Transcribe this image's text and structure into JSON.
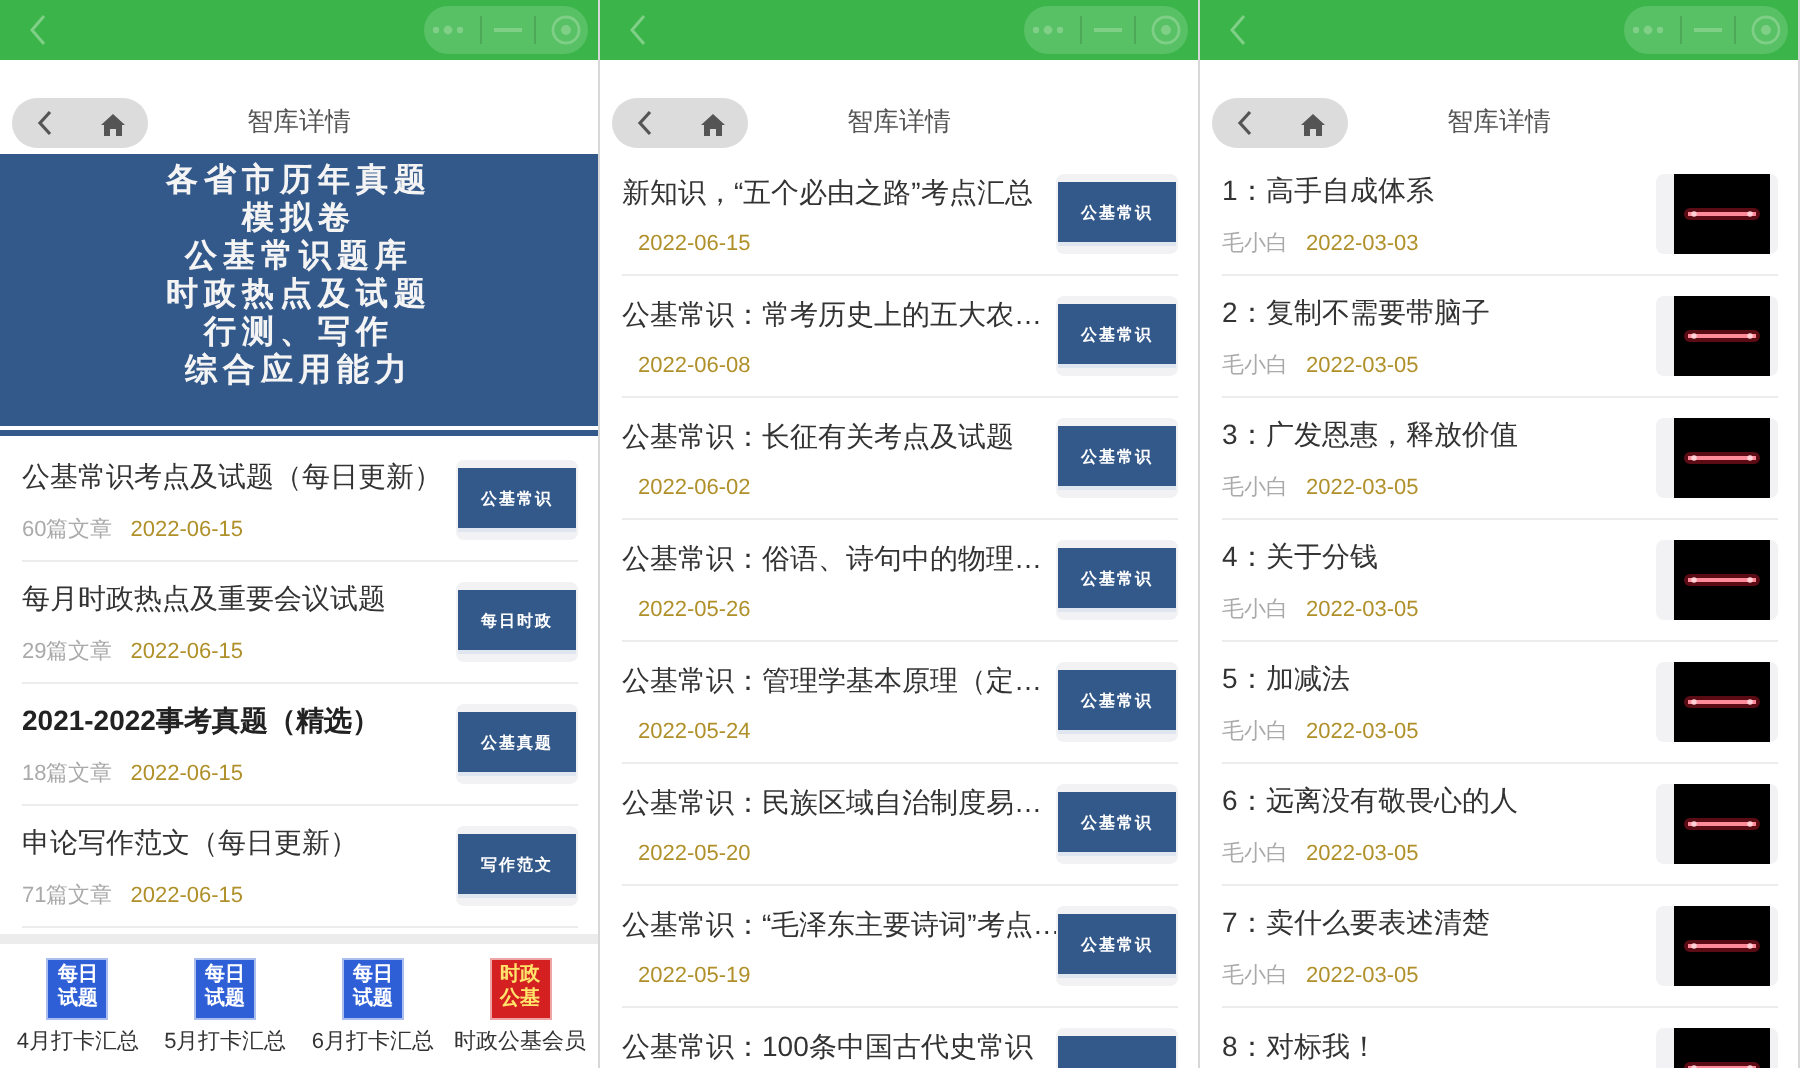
{
  "panels": [
    {
      "kind": "categories",
      "title": "智库详情",
      "banner": {
        "lines": [
          "各省市历年真题",
          "模拟卷",
          "公基常识题库",
          "时政热点及试题",
          "行测、写作",
          "综合应用能力"
        ]
      },
      "rows": [
        {
          "title": "公基常识考点及试题（每日更新）",
          "bold": false,
          "count": "60篇文章",
          "date": "2022-06-15",
          "thumb": {
            "kind": "cover",
            "text": "公基常识"
          }
        },
        {
          "title": "每月时政热点及重要会议试题",
          "bold": false,
          "count": "29篇文章",
          "date": "2022-06-15",
          "thumb": {
            "kind": "cover",
            "text": "每日时政"
          }
        },
        {
          "title": "2021-2022事考真题（精选）",
          "bold": true,
          "count": "18篇文章",
          "date": "2022-06-15",
          "thumb": {
            "kind": "cover",
            "text": "公基真题"
          }
        },
        {
          "title": "申论写作范文（每日更新）",
          "bold": false,
          "count": "71篇文章",
          "date": "2022-06-15",
          "thumb": {
            "kind": "cover",
            "text": "写作范文"
          }
        }
      ],
      "bottom_nav": [
        {
          "icon_lines": [
            "每日",
            "试题"
          ],
          "color": "#2f5fd6",
          "label": "4月打卡汇总"
        },
        {
          "icon_lines": [
            "每日",
            "试题"
          ],
          "color": "#2f5fd6",
          "label": "5月打卡汇总"
        },
        {
          "icon_lines": [
            "每日",
            "试题"
          ],
          "color": "#2f5fd6",
          "label": "6月打卡汇总"
        },
        {
          "icon_lines": [
            "时政",
            "公基"
          ],
          "color": "#d42020",
          "label": "时政公基会员"
        }
      ]
    },
    {
      "kind": "articles",
      "title": "智库详情",
      "rows": [
        {
          "title": "新知识，“五个必由之路”考点汇总",
          "date": "2022-06-15",
          "thumb": {
            "kind": "cover",
            "text": "公基常识"
          }
        },
        {
          "title": "公基常识：常考历史上的五大农…",
          "date": "2022-06-08",
          "thumb": {
            "kind": "cover",
            "text": "公基常识"
          }
        },
        {
          "title": "公基常识：长征有关考点及试题",
          "date": "2022-06-02",
          "thumb": {
            "kind": "cover",
            "text": "公基常识"
          }
        },
        {
          "title": "公基常识：俗语、诗句中的物理…",
          "date": "2022-05-26",
          "thumb": {
            "kind": "cover",
            "text": "公基常识"
          }
        },
        {
          "title": "公基常识：管理学基本原理（定…",
          "date": "2022-05-24",
          "thumb": {
            "kind": "cover",
            "text": "公基常识"
          }
        },
        {
          "title": "公基常识：民族区域自治制度易…",
          "date": "2022-05-20",
          "thumb": {
            "kind": "cover",
            "text": "公基常识"
          }
        },
        {
          "title": "公基常识：“毛泽东主要诗词”考点…",
          "date": "2022-05-19",
          "thumb": {
            "kind": "cover",
            "text": "公基常识"
          }
        },
        {
          "title": "公基常识：100条中国古代史常识",
          "thumb": {
            "kind": "cover"
          }
        }
      ]
    },
    {
      "kind": "articles",
      "title": "智库详情",
      "rows": [
        {
          "title": "1：高手自成体系",
          "author": "毛小白",
          "date": "2022-03-03"
        },
        {
          "title": "2：复制不需要带脑子",
          "author": "毛小白",
          "date": "2022-03-05"
        },
        {
          "title": "3：广发恩惠，释放价值",
          "author": "毛小白",
          "date": "2022-03-05"
        },
        {
          "title": "4：关于分钱",
          "author": "毛小白",
          "date": "2022-03-05"
        },
        {
          "title": "5：加减法",
          "author": "毛小白",
          "date": "2022-03-05"
        },
        {
          "title": "6：远离没有敬畏心的人",
          "author": "毛小白",
          "date": "2022-03-05"
        },
        {
          "title": "7：卖什么要表述清楚",
          "author": "毛小白",
          "date": "2022-03-05"
        },
        {
          "title": "8：对标我！"
        }
      ]
    }
  ]
}
